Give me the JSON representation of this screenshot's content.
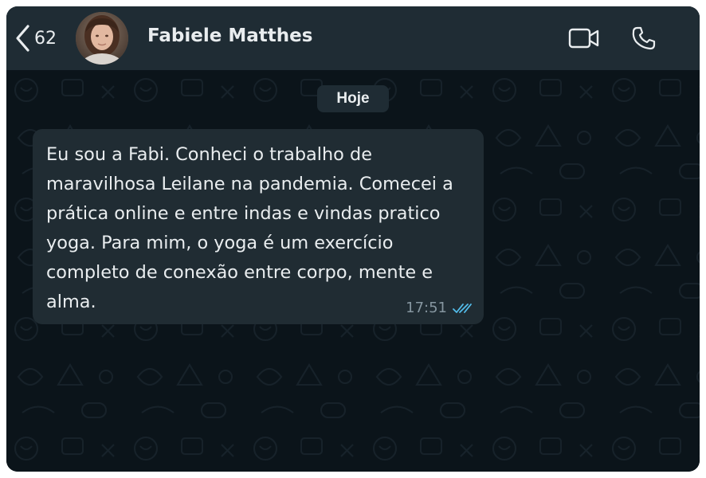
{
  "header": {
    "back_count": "62",
    "contact_name": "Fabiele Matthes"
  },
  "chat": {
    "date_chip": "Hoje",
    "messages": [
      {
        "text": "Eu sou a Fabi. Conheci o trabalho de maravilhosa Leilane na pandemia. Comecei a prática online e entre indas e vindas pratico yoga. Para mim, o yoga é um exercício completo de conexão entre corpo, mente e alma.",
        "time": "17:51",
        "status": "read"
      }
    ]
  },
  "icons": {
    "back": "chevron-left-icon",
    "video": "video-camera-icon",
    "call": "phone-icon",
    "read_receipt": "double-check-icon"
  },
  "colors": {
    "header_bg": "#1f2c34",
    "chat_bg": "#0b141a",
    "bubble_bg": "#202c33",
    "text": "#e9edef",
    "meta_text": "#8696a0",
    "read_tick": "#53bdeb"
  }
}
